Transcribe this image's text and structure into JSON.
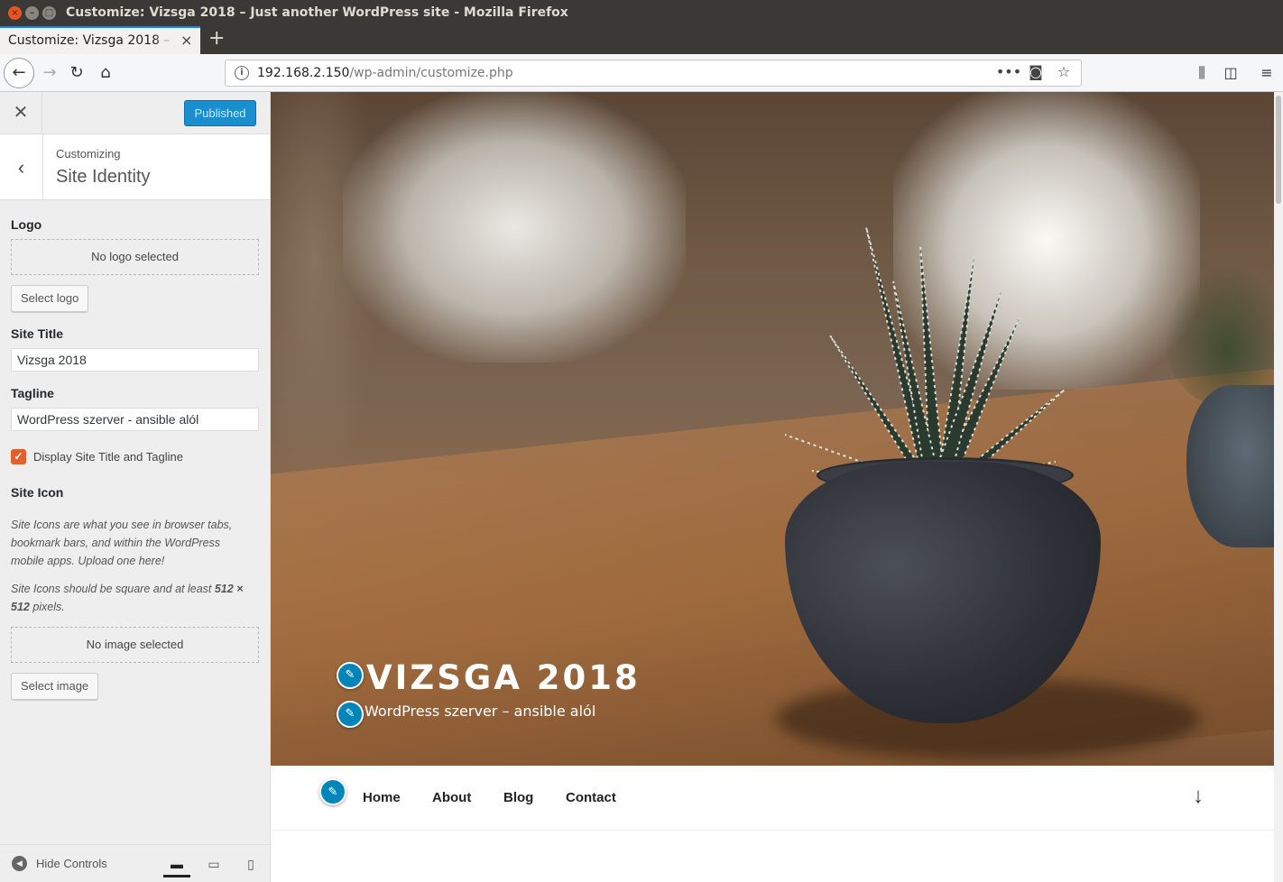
{
  "window": {
    "title": "Customize: Vizsga 2018 – Just another WordPress site - Mozilla Firefox"
  },
  "tab": {
    "title": "Customize: Vizsga 2018 – Just another WordPress site"
  },
  "urlbar": {
    "host": "192.168.2.150",
    "path": "/wp-admin/customize.php"
  },
  "header": {
    "publish_label": "Published"
  },
  "section": {
    "parent": "Customizing",
    "title": "Site Identity"
  },
  "logo": {
    "label": "Logo",
    "empty_text": "No logo selected",
    "button": "Select logo"
  },
  "site_title": {
    "label": "Site Title",
    "value": "Vizsga 2018"
  },
  "tagline": {
    "label": "Tagline",
    "value": "WordPress szerver - ansible alól"
  },
  "display_title": {
    "label": "Display Site Title and Tagline",
    "checked": true
  },
  "site_icon": {
    "label": "Site Icon",
    "description_1": "Site Icons are what you see in browser tabs, bookmark bars, and within the WordPress mobile apps. Upload one here!",
    "description_2_pre": "Site Icons should be square and at least ",
    "description_2_size": "512 × 512",
    "description_2_post": " pixels.",
    "empty_text": "No image selected",
    "button": "Select image"
  },
  "footer": {
    "hide_controls": "Hide Controls"
  },
  "preview": {
    "site_title": "VIZSGA 2018",
    "tagline": "WordPress szerver – ansible alól",
    "menu": [
      "Home",
      "About",
      "Blog",
      "Contact"
    ]
  },
  "colors": {
    "accent": "#0085ba",
    "publish": "#1a8fd0",
    "checkbox": "#e2612a",
    "firefox_tab_accent": "#0a84ff"
  }
}
